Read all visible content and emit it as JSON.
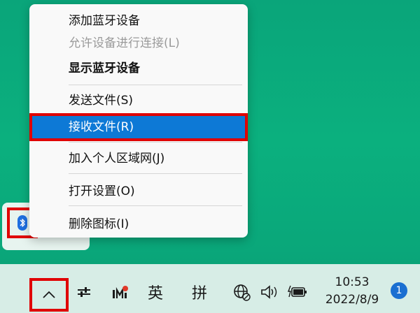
{
  "colors": {
    "accent": "#0d79d6",
    "highlight_outline": "#e00000",
    "desktop": "#0aa57a",
    "taskbar": "#d7ede6",
    "bluetooth_blue": "#1e6fe0"
  },
  "menu": {
    "items": [
      {
        "label": "添加蓝牙设备",
        "state": "normal"
      },
      {
        "label": "允许设备进行连接(L)",
        "state": "disabled"
      },
      {
        "label": "显示蓝牙设备",
        "state": "bold"
      },
      {
        "label": "发送文件(S)",
        "state": "normal"
      },
      {
        "label": "接收文件(R)",
        "state": "highlighted"
      },
      {
        "label": "加入个人区域网(J)",
        "state": "normal"
      },
      {
        "label": "打开设置(O)",
        "state": "normal"
      },
      {
        "label": "删除图标(I)",
        "state": "normal"
      }
    ]
  },
  "overflow_tray": {
    "icons": [
      "bluetooth-icon"
    ]
  },
  "taskbar": {
    "icons": [
      "chevron-up-icon",
      "sliders-icon",
      "ime-m-icon",
      "wifi-globe-icon",
      "volume-icon",
      "battery-charging-icon"
    ],
    "ime_lang": "英",
    "ime_mode": "拼",
    "time": "10:53",
    "date": "2022/8/9",
    "notification_count": "1"
  }
}
